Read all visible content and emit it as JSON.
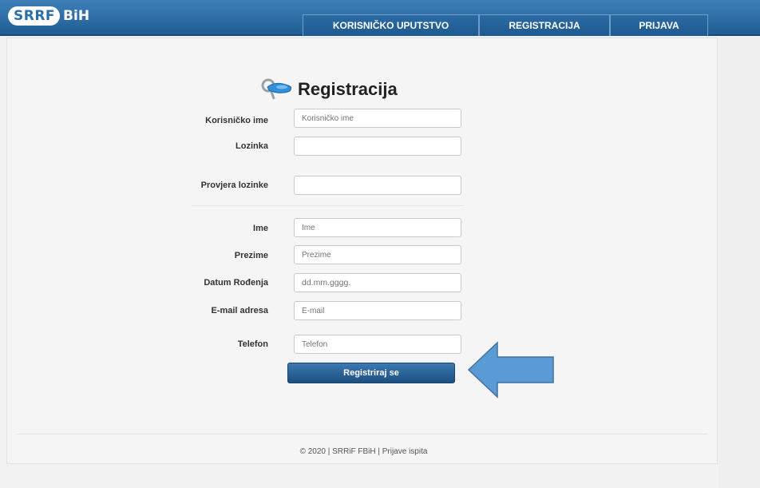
{
  "header": {
    "logo_badge": "SRRF",
    "logo_rest": "BiH",
    "nav": {
      "guide": "KORISNIČKO UPUTSTVO",
      "register": "REGISTRACIJA",
      "login": "PRIJAVA"
    }
  },
  "form": {
    "title": "Registracija",
    "username": {
      "label": "Korisničko ime",
      "placeholder": "Korisničko ime"
    },
    "password": {
      "label": "Lozinka",
      "placeholder": ""
    },
    "password_confirm": {
      "label": "Provjera lozinke",
      "placeholder": ""
    },
    "first_name": {
      "label": "Ime",
      "placeholder": "Ime"
    },
    "last_name": {
      "label": "Prezime",
      "placeholder": "Prezime"
    },
    "birth_date": {
      "label": "Datum Rođenja",
      "placeholder": "dd.mm.gggg."
    },
    "email": {
      "label": "E-mail adresa",
      "placeholder": "E-mail"
    },
    "phone": {
      "label": "Telefon",
      "placeholder": "Telefon"
    },
    "submit_label": "Registriraj se"
  },
  "footer": {
    "text": "© 2020 | SRRiF FBiH | Prijave ispita"
  },
  "colors": {
    "brand": "#1f5d94",
    "arrow": "#5b9bd5"
  }
}
